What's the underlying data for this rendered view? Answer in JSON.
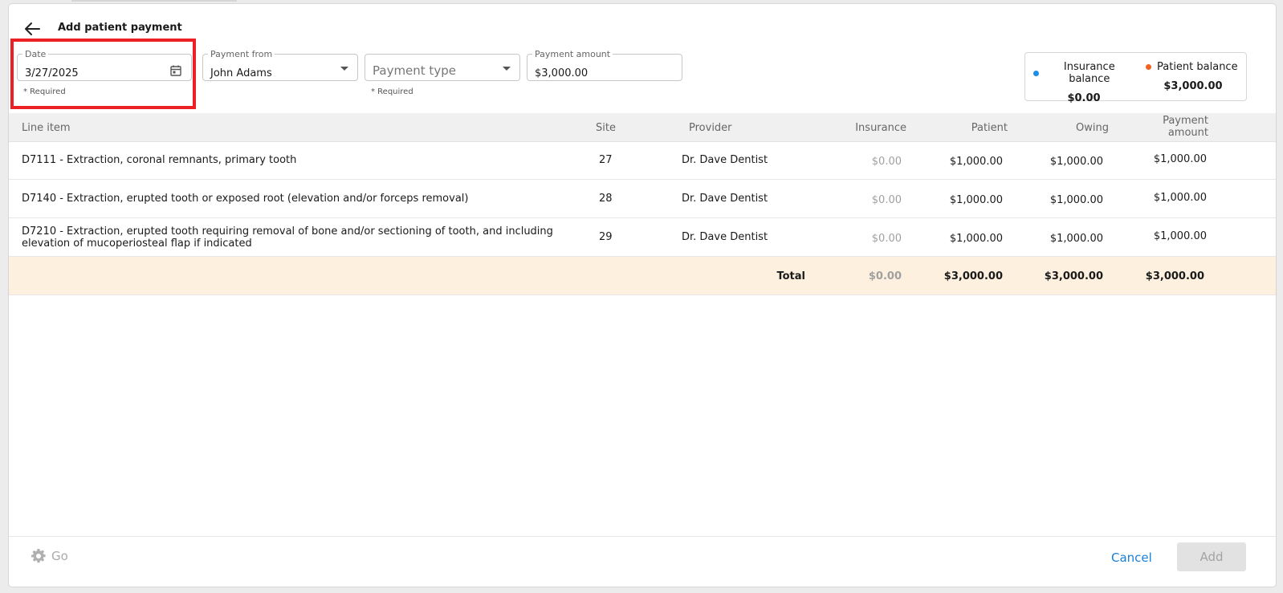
{
  "header": {
    "title": "Add patient payment"
  },
  "form": {
    "date": {
      "label": "Date",
      "value": "3/27/2025",
      "helper": "* Required"
    },
    "payment_from": {
      "label": "Payment from",
      "value": "John Adams"
    },
    "payment_type": {
      "placeholder": "Payment type",
      "helper": "* Required"
    },
    "payment_amount": {
      "label": "Payment amount",
      "value": "$3,000.00"
    }
  },
  "balances": {
    "insurance": {
      "label": "Insurance balance",
      "value": "$0.00",
      "color": "#1f8fe6"
    },
    "patient": {
      "label": "Patient balance",
      "value": "$3,000.00",
      "color": "#f0621f"
    }
  },
  "table": {
    "columns": {
      "line_item": "Line item",
      "site": "Site",
      "provider": "Provider",
      "insurance": "Insurance",
      "patient": "Patient",
      "owing": "Owing",
      "payment_amount_1": "Payment",
      "payment_amount_2": "amount"
    },
    "rows": [
      {
        "line_item": "D7111 - Extraction, coronal remnants, primary tooth",
        "line_item_2": "",
        "site": "27",
        "provider": "Dr. Dave Dentist",
        "insurance": "$0.00",
        "patient": "$1,000.00",
        "owing": "$1,000.00",
        "payment_amount": "$1,000.00"
      },
      {
        "line_item": "D7140 - Extraction, erupted tooth or exposed root (elevation and/or forceps removal)",
        "line_item_2": "",
        "site": "28",
        "provider": "Dr. Dave Dentist",
        "insurance": "$0.00",
        "patient": "$1,000.00",
        "owing": "$1,000.00",
        "payment_amount": "$1,000.00"
      },
      {
        "line_item": "D7210 - Extraction, erupted tooth requiring removal of bone and/or sectioning of tooth, and including",
        "line_item_2": "elevation of mucoperiosteal flap if indicated",
        "site": "29",
        "provider": "Dr. Dave Dentist",
        "insurance": "$0.00",
        "patient": "$1,000.00",
        "owing": "$1,000.00",
        "payment_amount": "$1,000.00"
      }
    ],
    "total": {
      "label": "Total",
      "insurance": "$0.00",
      "patient": "$3,000.00",
      "owing": "$3,000.00",
      "payment_amount": "$3,000.00"
    }
  },
  "footer": {
    "go_label": "Go",
    "cancel_label": "Cancel",
    "add_label": "Add"
  },
  "colors": {
    "accent": "#1a7fd6",
    "highlight": "#ec1f24",
    "total_row_bg": "#fdf0de"
  }
}
